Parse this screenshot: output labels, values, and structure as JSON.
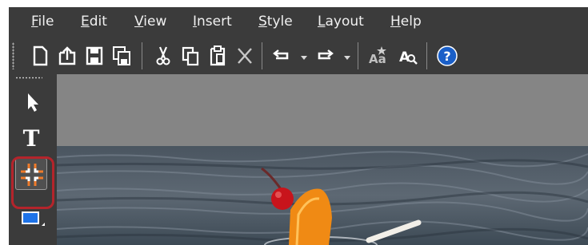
{
  "menubar": {
    "items": [
      {
        "key": "F",
        "rest": "ile"
      },
      {
        "key": "E",
        "rest": "dit"
      },
      {
        "key": "V",
        "rest": "iew"
      },
      {
        "key": "I",
        "rest": "nsert"
      },
      {
        "key": "S",
        "rest": "tyle"
      },
      {
        "key": "L",
        "rest": "ayout"
      },
      {
        "key": "H",
        "rest": "elp"
      }
    ]
  },
  "toolbar": {
    "icons": [
      "new-document-icon",
      "open-icon",
      "save-icon",
      "save-all-icon",
      "cut-icon",
      "copy-icon",
      "paste-icon",
      "delete-icon",
      "undo-icon",
      "redo-icon",
      "spell-check-icon",
      "find-icon",
      "help-icon"
    ],
    "help_label": "?"
  },
  "toolbox": {
    "tools": [
      "pointer-tool",
      "text-tool",
      "crop-tool",
      "shape-tool"
    ],
    "text_tool_label": "T",
    "selected": "crop-tool"
  },
  "colors": {
    "background": "#3b3b3b",
    "canvas": "#858585",
    "highlight": "#b4242b",
    "crop_accent": "#f07b2a",
    "shape_blue": "#1e73e8",
    "help_blue": "#1a5fc8"
  }
}
